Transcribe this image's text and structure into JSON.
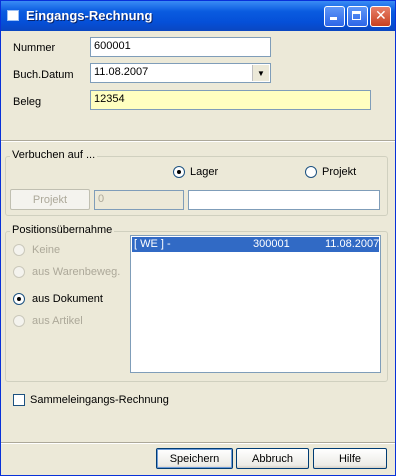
{
  "window": {
    "title": "Eingangs-Rechnung"
  },
  "form": {
    "nummer_label": "Nummer",
    "nummer_value": "600001",
    "buchdatum_label": "Buch.Datum",
    "buchdatum_value": "11.08.2007",
    "beleg_label": "Beleg",
    "beleg_value": "12354"
  },
  "verbuchen": {
    "title": "Verbuchen auf ...",
    "options": [
      {
        "label": "Lager",
        "selected": true
      },
      {
        "label": "Projekt",
        "selected": false
      }
    ],
    "projekt_button": "Projekt",
    "projekt_number": "0",
    "projekt_name": ""
  },
  "positions": {
    "title": "Positionsübernahme",
    "options": [
      {
        "label": "Keine",
        "selected": false,
        "enabled": false
      },
      {
        "label": "aus Warenbeweg.",
        "selected": false,
        "enabled": false
      },
      {
        "label": "aus Dokument",
        "selected": true,
        "enabled": true
      },
      {
        "label": "aus Artikel",
        "selected": false,
        "enabled": false
      }
    ],
    "list_rows": [
      {
        "col1": "[ WE ] -",
        "col2": "300001",
        "col3": "11.08.2007",
        "selected": true
      }
    ]
  },
  "sammel": {
    "label": "Sammeleingangs-Rechnung",
    "checked": false
  },
  "buttons": {
    "save": "Speichern",
    "cancel": "Abbruch",
    "help": "Hilfe"
  },
  "colors": {
    "titlebar": "#0550d8",
    "selection": "#316ac5",
    "highlight_field": "#ffffc0",
    "dialog_bg": "#ece9d8"
  }
}
